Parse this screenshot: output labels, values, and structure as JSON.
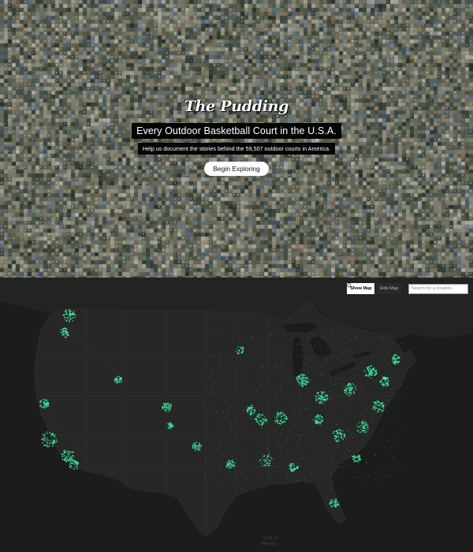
{
  "hero": {
    "logo": "The Pudding",
    "title": "Every Outdoor Basketball Court in the U.S.A.",
    "subtitle": "Help us document the stories behind the 59,507 outdoor courts in America.",
    "cta_label": "Begin Exploring",
    "background": "mosaic of satellite court images"
  },
  "map": {
    "controls": {
      "show_map_label": "Show Map",
      "hide_map_label": "Hide Map",
      "active": "show_map"
    },
    "search": {
      "placeholder": "Search for a location..."
    },
    "labels": {
      "gulf": "Gulf of",
      "mexico": "Mexico"
    },
    "colors": {
      "land": "#262626",
      "water": "#1b1b1b",
      "courts": "#3ff0a0",
      "borders": "#3a3a3a"
    }
  }
}
